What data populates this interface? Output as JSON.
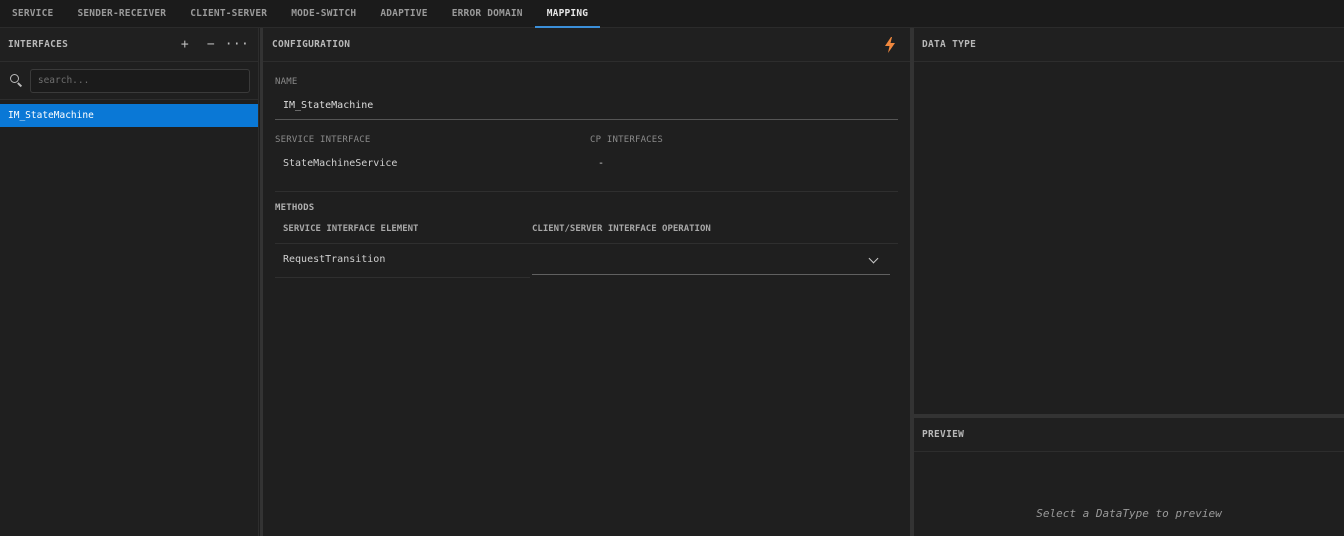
{
  "tabs": [
    {
      "label": "SERVICE",
      "active": false
    },
    {
      "label": "SENDER-RECEIVER",
      "active": false
    },
    {
      "label": "CLIENT-SERVER",
      "active": false
    },
    {
      "label": "MODE-SWITCH",
      "active": false
    },
    {
      "label": "ADAPTIVE",
      "active": false
    },
    {
      "label": "ERROR DOMAIN",
      "active": false
    },
    {
      "label": "MAPPING",
      "active": true
    }
  ],
  "interfaces_panel": {
    "title": "INTERFACES",
    "add_label": "+",
    "remove_label": "−",
    "more_label": "···",
    "search_placeholder": "search...",
    "items": [
      {
        "label": "IM_StateMachine",
        "selected": true
      }
    ]
  },
  "configuration": {
    "title": "CONFIGURATION",
    "name_label": "NAME",
    "name_value": "IM_StateMachine",
    "service_interface_label": "SERVICE INTERFACE",
    "service_interface_value": "StateMachineService",
    "cp_interfaces_label": "CP INTERFACES",
    "cp_interfaces_value": "-",
    "methods_label": "METHODS",
    "columns": [
      "SERVICE INTERFACE ELEMENT",
      "CLIENT/SERVER INTERFACE OPERATION"
    ],
    "rows": [
      {
        "element": "RequestTransition",
        "operation": ""
      }
    ],
    "bolt_color": "#f0883e"
  },
  "data_type_panel": {
    "title": "DATA TYPE"
  },
  "preview_panel": {
    "title": "PREVIEW",
    "empty_text": "Select a DataType to preview"
  },
  "colors": {
    "accent": "#0a78d6",
    "tab_underline": "#3b8fd9"
  }
}
